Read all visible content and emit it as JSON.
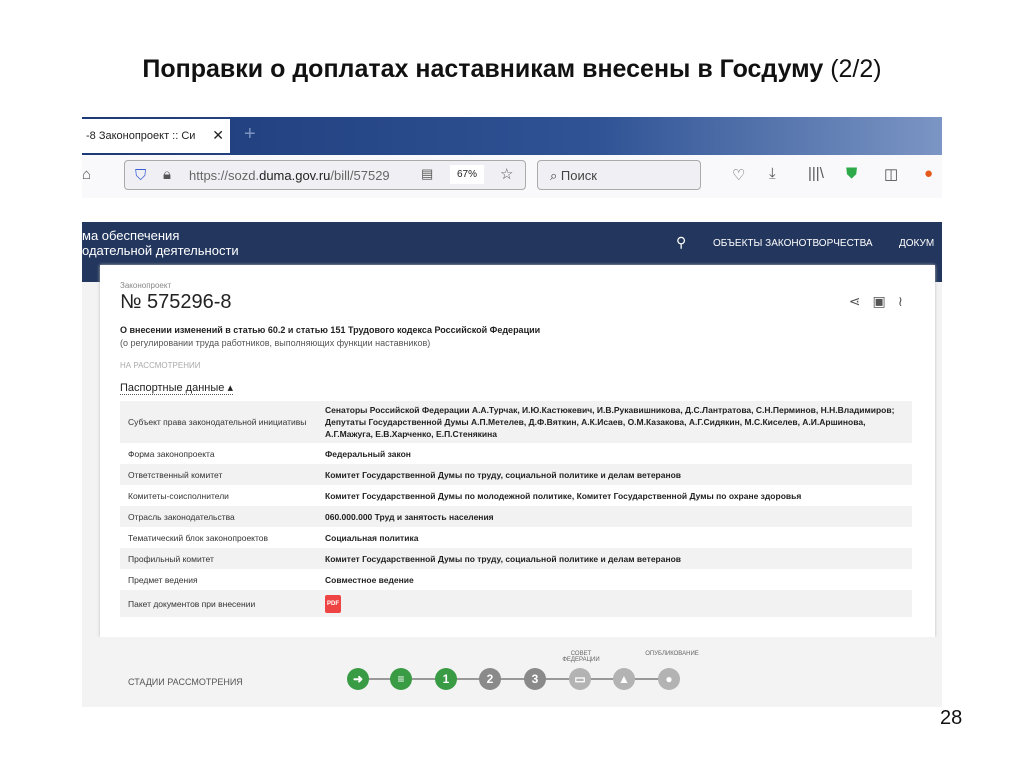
{
  "slide": {
    "title": "Поправки о доплатах наставникам внесены в Госдуму",
    "title_suffix": "(2/2)",
    "page_number": "28"
  },
  "browser": {
    "tab_title": "-8 Законопроект :: Си",
    "url_prefix": "https://sozd.",
    "url_domain": "duma.gov.ru",
    "url_path": "/bill/57529",
    "zoom": "67%",
    "search_placeholder": "Поиск"
  },
  "site": {
    "name_line1": "ма обеспечения",
    "name_line2": "одательной деятельности",
    "menu": [
      "ОБЪЕКТЫ ЗАКОНОТВОРЧЕСТВА",
      "ДОКУМ"
    ]
  },
  "bill": {
    "label": "Законопроект",
    "number": "№ 575296-8",
    "title": "О внесении изменений в статью 60.2 и статью 151 Трудового кодекса Российской Федерации",
    "subtitle": "(о регулировании труда работников, выполняющих функции наставников)",
    "status": "НА РАССМОТРЕНИИ",
    "section": "Паспортные данные"
  },
  "passport": [
    {
      "k": "Субъект права законодательной инициативы",
      "v": "Сенаторы Российской Федерации А.А.Турчак, И.Ю.Кастюкевич, И.В.Рукавишникова, Д.С.Лантратова, С.Н.Перминов, Н.Н.Владимиров; Депутаты Государственной Думы А.П.Метелев, Д.Ф.Вяткин, А.К.Исаев, О.М.Казакова, А.Г.Сидякин, М.С.Киселев, А.И.Аршинова, А.Г.Мажуга, Е.В.Харченко, Е.П.Стенякина"
    },
    {
      "k": "Форма законопроекта",
      "v": "Федеральный закон"
    },
    {
      "k": "Ответственный комитет",
      "v": "Комитет Государственной Думы по труду, социальной политике и делам ветеранов"
    },
    {
      "k": "Комитеты-соисполнители",
      "v": "Комитет Государственной Думы по молодежной политике, Комитет Государственной Думы по охране здоровья"
    },
    {
      "k": "Отрасль законодательства",
      "v": "060.000.000 Труд и занятость населения"
    },
    {
      "k": "Тематический блок законопроектов",
      "v": "Социальная политика"
    },
    {
      "k": "Профильный комитет",
      "v": "Комитет Государственной Думы по труду, социальной политике и делам ветеранов"
    },
    {
      "k": "Предмет ведения",
      "v": "Совместное ведение"
    },
    {
      "k": "Пакет документов при внесении",
      "v": ""
    }
  ],
  "pdf_label": "PDF",
  "stages": {
    "label": "СТАДИИ РАССМОТРЕНИЯ",
    "cap_fed": "СОВЕТ ФЕДЕРАЦИИ",
    "cap_pub": "ОПУБЛИКОВАНИЕ",
    "steps": [
      "➜",
      "≡",
      "1",
      "2",
      "3",
      "▭",
      "▲",
      "●"
    ]
  }
}
